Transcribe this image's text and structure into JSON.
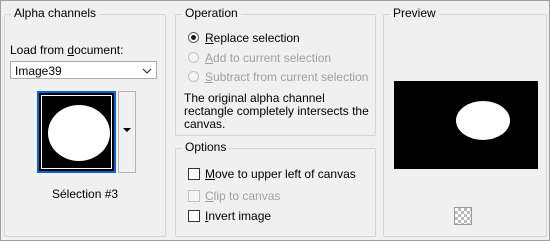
{
  "alpha_channels": {
    "title": "Alpha channels",
    "load_from_label": "Load from document:",
    "document_value": "Image39",
    "selection_caption": "Sélection #3"
  },
  "operation": {
    "title": "Operation",
    "options": [
      {
        "label": "Replace selection",
        "selected": true,
        "enabled": true
      },
      {
        "label": "Add to current selection",
        "selected": false,
        "enabled": false
      },
      {
        "label": "Subtract from current selection",
        "selected": false,
        "enabled": false
      }
    ],
    "info_text": "The original alpha channel rectangle completely intersects the canvas."
  },
  "options": {
    "title": "Options",
    "items": [
      {
        "label": "Move to upper left of canvas",
        "checked": false,
        "enabled": true
      },
      {
        "label": "Clip to canvas",
        "checked": false,
        "enabled": false
      },
      {
        "label": "Invert image",
        "checked": false,
        "enabled": true
      }
    ]
  },
  "preview": {
    "title": "Preview"
  }
}
